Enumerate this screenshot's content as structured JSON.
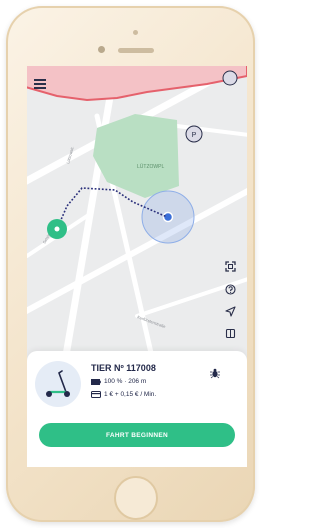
{
  "device": {
    "model": "smartphone"
  },
  "map": {
    "park_label": "LÜTZOWPL",
    "street_labels": [
      "Lützowstr.",
      "Schöneberger",
      "Kurfürstenstraße"
    ],
    "colors": {
      "restricted_zone": "#e5616c",
      "park": "#b9dfc3",
      "route": "#2a2f7a",
      "accent": "#2fbf87",
      "user_location": "#3a6fd8"
    }
  },
  "icons": {
    "menu": "hamburger-menu-icon",
    "scan": "qr-scan-icon",
    "help": "question-icon",
    "locate": "navigation-arrow-icon",
    "map_toggle": "map-layer-icon",
    "scooter": "scooter-icon",
    "battery": "battery-icon",
    "price": "card-icon",
    "bug": "bug-icon"
  },
  "vehicle": {
    "name": "TIER Nº 117008",
    "battery": "100 % · 206 m",
    "price": "1 € + 0,15 € / Min."
  },
  "actions": {
    "start_label": "FAHRT BEGINNEN"
  }
}
